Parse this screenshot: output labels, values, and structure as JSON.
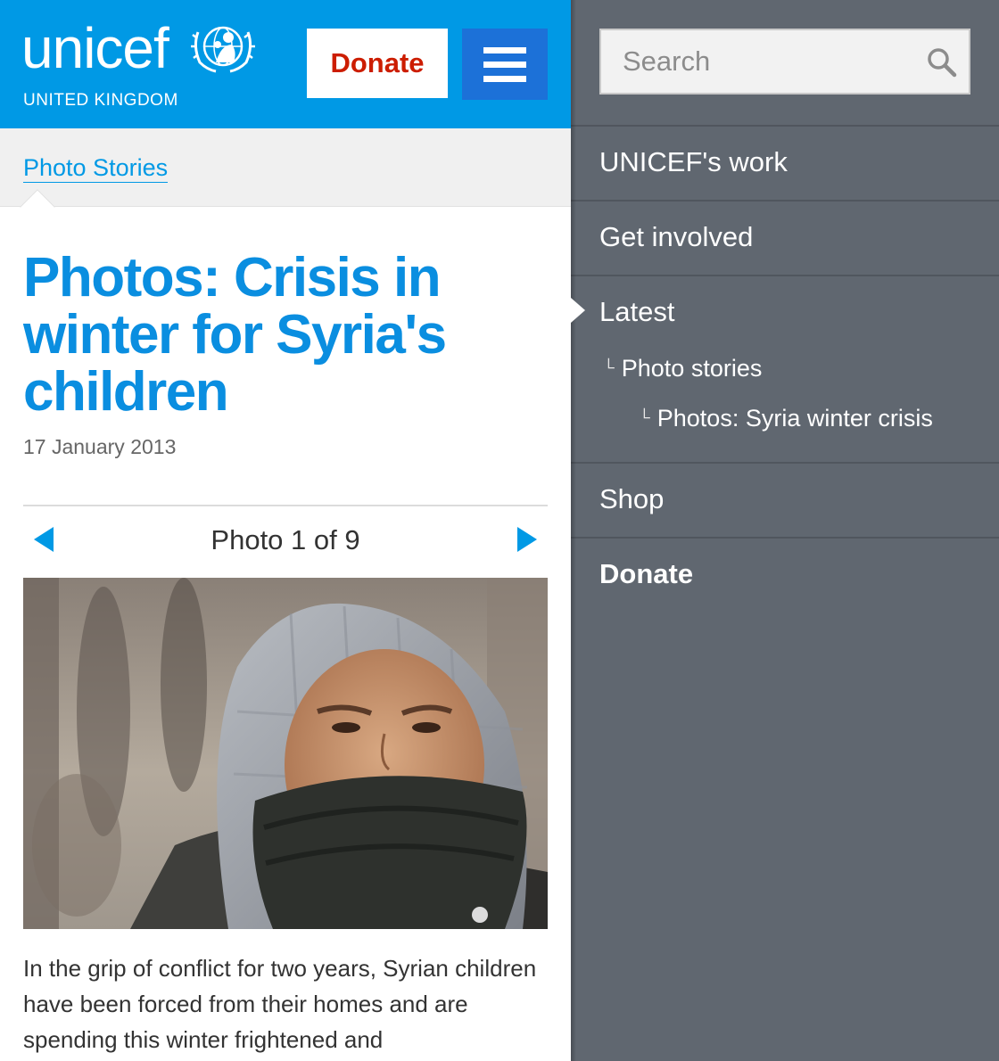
{
  "header": {
    "logo_text": "unicef",
    "logo_subtitle": "UNITED KINGDOM",
    "donate_label": "Donate",
    "menu_icon": "hamburger-menu-icon",
    "brand_color": "#0099e5",
    "donate_color": "#cc1d00"
  },
  "breadcrumb": {
    "label": "Photo Stories"
  },
  "article": {
    "title": "Photos: Crisis in winter for Syria's children",
    "date": "17 January 2013",
    "gallery": {
      "counter": "Photo 1 of 9",
      "prev_icon": "triangle-left-icon",
      "next_icon": "triangle-right-icon",
      "current": 1,
      "total": 9
    },
    "body": "In the grip of conflict for two years, Syrian children have been forced from their homes and are spending this winter frightened and"
  },
  "sidebar": {
    "search": {
      "placeholder": "Search",
      "value": "",
      "icon": "search-icon"
    },
    "items": [
      {
        "label": "UNICEF's work"
      },
      {
        "label": "Get involved"
      },
      {
        "label": "Latest",
        "active": true
      },
      {
        "label": "Shop"
      },
      {
        "label": "Donate",
        "bold": true
      }
    ],
    "subitems": [
      {
        "label": "Photo stories",
        "level": 1
      },
      {
        "label": "Photos: Syria winter crisis",
        "level": 2
      }
    ],
    "background": "#606770"
  }
}
